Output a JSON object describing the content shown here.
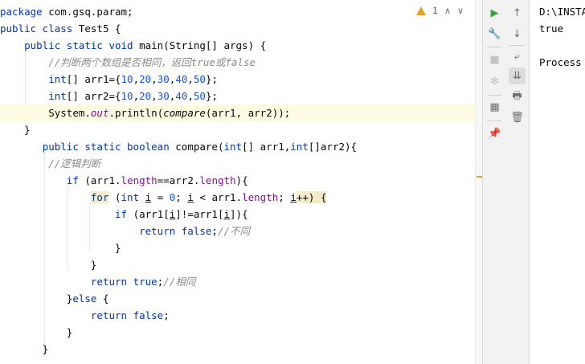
{
  "editor": {
    "line1": {
      "kw_package": "package",
      "pkg": " com.gsq.param;"
    },
    "line2": {
      "kw_public": "public",
      "kw_class": " class",
      "rest": " Test5 {"
    },
    "line3": {
      "indent": "    ",
      "kw": "public static void",
      "rest": " main(String[] args) {"
    },
    "line4": {
      "indent": "        ",
      "comment": "//判断两个数组是否相同，返回true或false"
    },
    "line5": {
      "indent": "        ",
      "kw": "int",
      "a": "[] arr1={",
      "n1": "10",
      "c1": ",",
      "n2": "20",
      "c2": ",",
      "n3": "30",
      "c3": ",",
      "n4": "40",
      "c4": ",",
      "n5": "50",
      "end": "};"
    },
    "line6": {
      "indent": "        ",
      "kw": "int",
      "a": "[] arr2={",
      "n1": "10",
      "c1": ",",
      "n2": "20",
      "c2": ",",
      "n3": "30",
      "c3": ",",
      "n4": "40",
      "c4": ",",
      "n5": "50",
      "end": "};"
    },
    "line7": {
      "indent": "        ",
      "a": "System.",
      "out": "out",
      "b": ".println(",
      "call": "compare",
      "c": "(arr1, arr2));"
    },
    "line8": {
      "text": "    }"
    },
    "line9": {
      "indent": "       ",
      "kw": "public static boolean",
      "a": " compare(",
      "kw2": "int",
      "b": "[] arr1,",
      "kw3": "int",
      "c": "[]arr2){"
    },
    "line10": {
      "indent": "        ",
      "comment": "//逻辑判断"
    },
    "line11": {
      "indent": "           ",
      "kw": "if",
      "a": " (arr1.",
      "f1": "length",
      "b": "==arr2.",
      "f2": "length",
      "c": "){"
    },
    "line12": {
      "indent": "               ",
      "kw": "for",
      "a": " (",
      "kw2": "int",
      "sp": " ",
      "i1": "i",
      "b": " = ",
      "n0": "0",
      "c": "; ",
      "i2": "i",
      "d": " < arr1.",
      "f": "length",
      "e": "; ",
      "i3": "i",
      "g": "++) {"
    },
    "line13": {
      "indent": "                   ",
      "kw": "if",
      "a": " (arr1[",
      "i1": "i",
      "b": "]!=arr1[",
      "i2": "i",
      "c": "]){"
    },
    "line14": {
      "indent": "                       ",
      "kw": "return false",
      "a": ";",
      "comment": "//不同"
    },
    "line15": {
      "text": "                   }"
    },
    "line16": {
      "text": "               }"
    },
    "line17": {
      "indent": "               ",
      "kw": "return true",
      "a": ";",
      "comment": "//相同"
    },
    "line18": {
      "indent": "           ",
      "a": "}",
      "kw": "else",
      "b": " {"
    },
    "line19": {
      "indent": "               ",
      "kw": "return false",
      "a": ";"
    },
    "line20": {
      "text": "           }"
    },
    "line21": {
      "text": "       }"
    }
  },
  "status": {
    "warnings": "1",
    "up": "∧",
    "down": "∨"
  },
  "toolbar": {
    "run_icon": "▶",
    "wrench_icon": "🔧",
    "stop_icon": "■",
    "debug_icon": "✻",
    "layout_icon": "▦",
    "pin_icon": "📌",
    "up_icon": "↑",
    "down_icon": "↓",
    "wrap_icon": "⤶",
    "scroll_icon": "⇊",
    "print_icon": "🖶",
    "trash_icon": "🗑"
  },
  "colors": {
    "accent": "#4a8cf0",
    "warning": "#e6a322",
    "run": "#3f9f3f"
  },
  "console": {
    "line1": "D:\\INSTA",
    "line2": "true",
    "line3": "Process"
  }
}
